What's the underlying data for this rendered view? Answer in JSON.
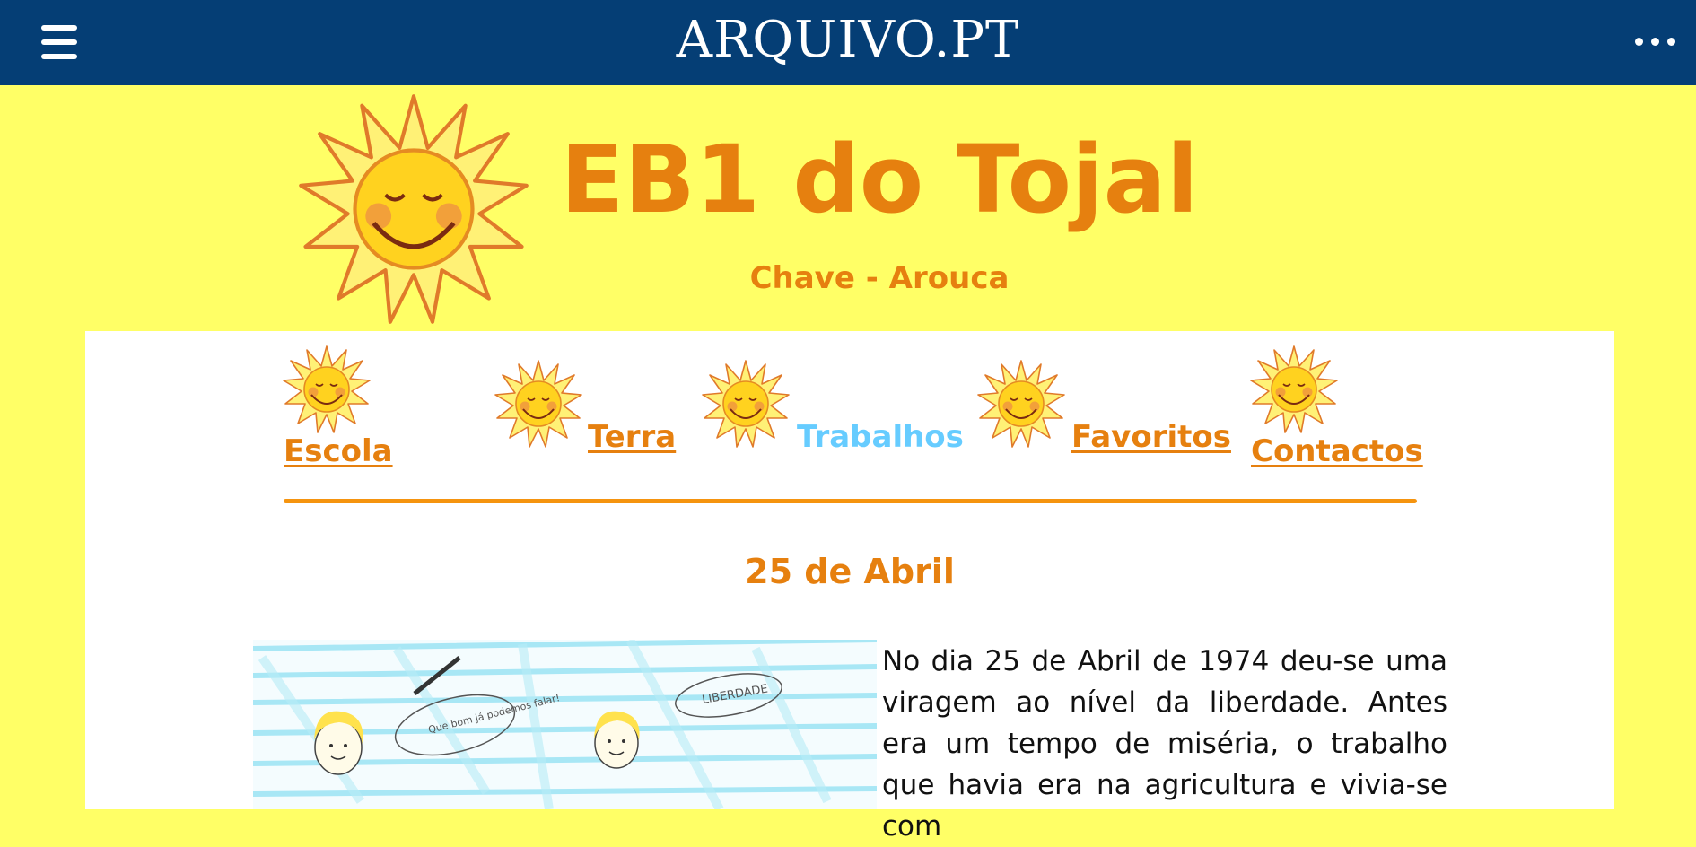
{
  "header": {
    "logo": "ARQUIVO.PT",
    "menu_icon": "hamburger-menu-icon",
    "more_icon": "more-options-icon",
    "background": "#053e75"
  },
  "site": {
    "title": "EB1 do Tojal",
    "subtitle": "Chave - Arouca",
    "background": "#ffff66",
    "accent": "#e6800f",
    "active_color": "#66ccff"
  },
  "nav": {
    "items": [
      {
        "label": "Escola",
        "active": false
      },
      {
        "label": "Terra",
        "active": false
      },
      {
        "label": "Trabalhos",
        "active": true
      },
      {
        "label": "Favoritos",
        "active": false
      },
      {
        "label": "Contactos",
        "active": false
      }
    ]
  },
  "article": {
    "title": "25 de Abril",
    "body": "No dia 25 de Abril de 1974 deu-se uma viragem ao nível da liberdade. Antes era um tempo de miséria, o trabalho que havia era na agricultura e vivia-se com",
    "drawing_speech_1": "Que bom já podemos falar!",
    "drawing_speech_2": "LIBERDADE"
  }
}
